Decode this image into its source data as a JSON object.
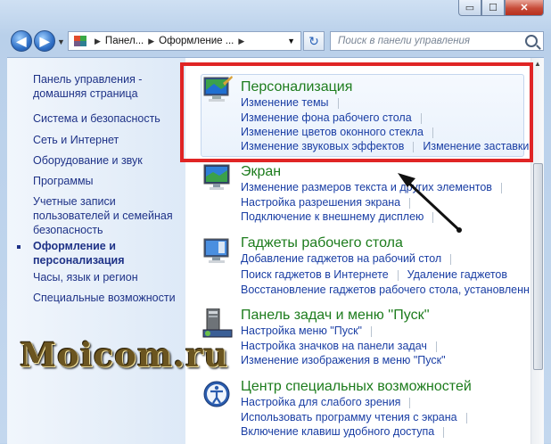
{
  "window": {
    "caption": {
      "minimize": "▭",
      "maximize": "☐",
      "close": "✕"
    }
  },
  "nav": {
    "back": "◀",
    "forward": "▶",
    "recent": "▼",
    "breadcrumb": [
      "Панел...",
      "Оформление ..."
    ],
    "refresh": "↻",
    "search_placeholder": "Поиск в панели управления"
  },
  "sidebar": {
    "items": [
      "Панель управления -",
      "домашняя страница",
      "Система и безопасность",
      "Сеть и Интернет",
      "Оборудование и звук",
      "Программы",
      "Учетные записи",
      "пользователей и семейная",
      "безопасность",
      "Оформление и",
      "персонализация",
      "Часы, язык и регион",
      "Специальные возможности"
    ]
  },
  "categories": [
    {
      "title": "Персонализация",
      "links": [
        [
          "Изменение темы"
        ],
        [
          "Изменение фона рабочего стола"
        ],
        [
          "Изменение цветов оконного стекла"
        ],
        [
          "Изменение звуковых эффектов",
          "Изменение заставки"
        ]
      ]
    },
    {
      "title": "Экран",
      "links": [
        [
          "Изменение размеров текста и других элементов"
        ],
        [
          "Настройка разрешения экрана"
        ],
        [
          "Подключение к внешнему дисплею"
        ]
      ]
    },
    {
      "title": "Гаджеты рабочего стола",
      "links": [
        [
          "Добавление гаджетов на рабочий стол"
        ],
        [
          "Поиск гаджетов в Интернете",
          "Удаление гаджетов"
        ],
        [
          "Восстановление гаджетов рабочего стола, установленн"
        ]
      ]
    },
    {
      "title": "Панель задач и меню ''Пуск''",
      "links": [
        [
          "Настройка меню \"Пуск\""
        ],
        [
          "Настройка значков на панели задач"
        ],
        [
          "Изменение изображения в меню \"Пуск\""
        ]
      ]
    },
    {
      "title": "Центр специальных возможностей",
      "links": [
        [
          "Настройка для слабого зрения"
        ],
        [
          "Использовать программу чтения с экрана"
        ],
        [
          "Включение клавиш удобного доступа"
        ]
      ]
    }
  ],
  "watermark": "Moicom.ru",
  "colors": {
    "highlight_border": "#e02525",
    "category_title": "#1d7c1d",
    "link": "#1a3ea4"
  }
}
